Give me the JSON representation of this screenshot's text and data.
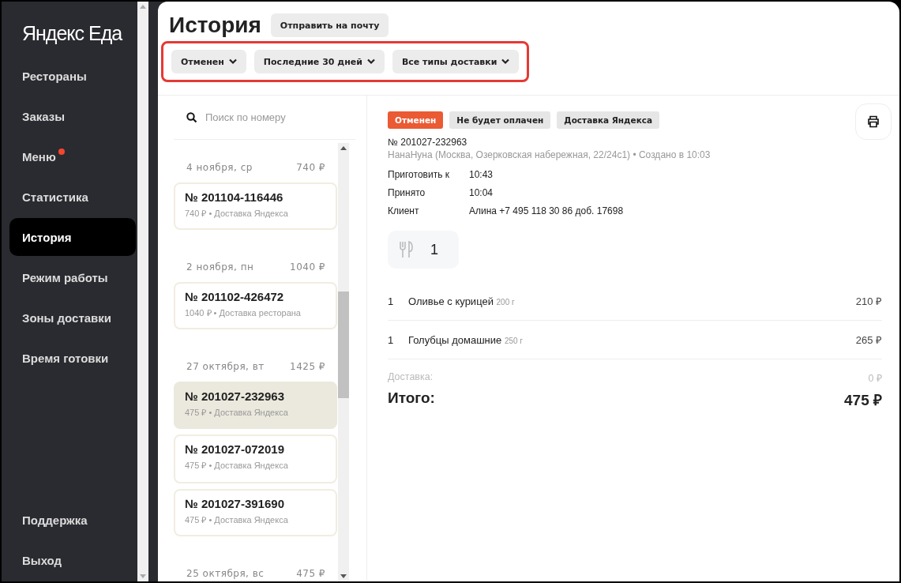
{
  "sidebar": {
    "logo": {
      "brand": "Яндекс",
      "product": "Еда"
    },
    "items": [
      {
        "label": "Рестораны",
        "selected": false,
        "notification": false
      },
      {
        "label": "Заказы",
        "selected": false,
        "notification": false
      },
      {
        "label": "Меню",
        "selected": false,
        "notification": true
      },
      {
        "label": "Статистика",
        "selected": false,
        "notification": false
      },
      {
        "label": "История",
        "selected": true,
        "notification": false
      },
      {
        "label": "Режим работы",
        "selected": false,
        "notification": false
      },
      {
        "label": "Зоны доставки",
        "selected": false,
        "notification": false
      },
      {
        "label": "Время готовки",
        "selected": false,
        "notification": false
      }
    ],
    "bottom_items": [
      {
        "label": "Поддержка",
        "selected": false,
        "notification": false
      },
      {
        "label": "Выход",
        "selected": false,
        "notification": false
      }
    ]
  },
  "header": {
    "title": "История",
    "email_button": "Отправить на почту",
    "filters": [
      "Отменен",
      "Последние 30 дней",
      "Все типы доставки"
    ]
  },
  "search": {
    "placeholder": "Поиск по номеру"
  },
  "order_groups": [
    {
      "date": "4 ноября, ср",
      "total": "740 ₽",
      "orders": [
        {
          "number": "№ 201104-116446",
          "details": "740 ₽ • Доставка Яндекса",
          "selected": false
        }
      ]
    },
    {
      "date": "2 ноября, пн",
      "total": "1040 ₽",
      "orders": [
        {
          "number": "№ 201102-426472",
          "details": "1040 ₽ • Доставка ресторана",
          "selected": false
        }
      ]
    },
    {
      "date": "27 октября, вт",
      "total": "1425 ₽",
      "orders": [
        {
          "number": "№ 201027-232963",
          "details": "475 ₽ • Доставка Яндекса",
          "selected": true
        },
        {
          "number": "№ 201027-072019",
          "details": "475 ₽ • Доставка Яндекса",
          "selected": false
        },
        {
          "number": "№ 201027-391690",
          "details": "475 ₽ • Доставка Яндекса",
          "selected": false
        }
      ]
    },
    {
      "date": "25 октября, вс",
      "total": "475 ₽"
    }
  ],
  "detail": {
    "tags": [
      {
        "label": "Отменен",
        "color": "#ea5a33"
      },
      {
        "label": "Не будет оплачен",
        "color": "#e6e6e6"
      },
      {
        "label": "Доставка Яндекса",
        "color": "#e6e6e6"
      }
    ],
    "number": "№ 201027-232963",
    "meta": "НанаНуна (Москва, Озерковская набережная, 22/24с1) • Создано в 10:03",
    "fields": [
      {
        "label": "Приготовить к",
        "value": "10:43"
      },
      {
        "label": "Принято",
        "value": "10:04"
      },
      {
        "label": "Клиент",
        "value": "Алина +7 495 118 30 86 доб. 17698"
      }
    ],
    "cutlery": "1",
    "items": [
      {
        "qty": "1",
        "name": "Оливье с курицей",
        "weight": "200 г",
        "price": "210 ₽"
      },
      {
        "qty": "1",
        "name": "Голубцы домашние",
        "weight": "250 г",
        "price": "265 ₽"
      }
    ],
    "delivery": {
      "label": "Доставка:",
      "value": "0 ₽"
    },
    "total": {
      "label": "Итого:",
      "value": "475 ₽"
    }
  }
}
